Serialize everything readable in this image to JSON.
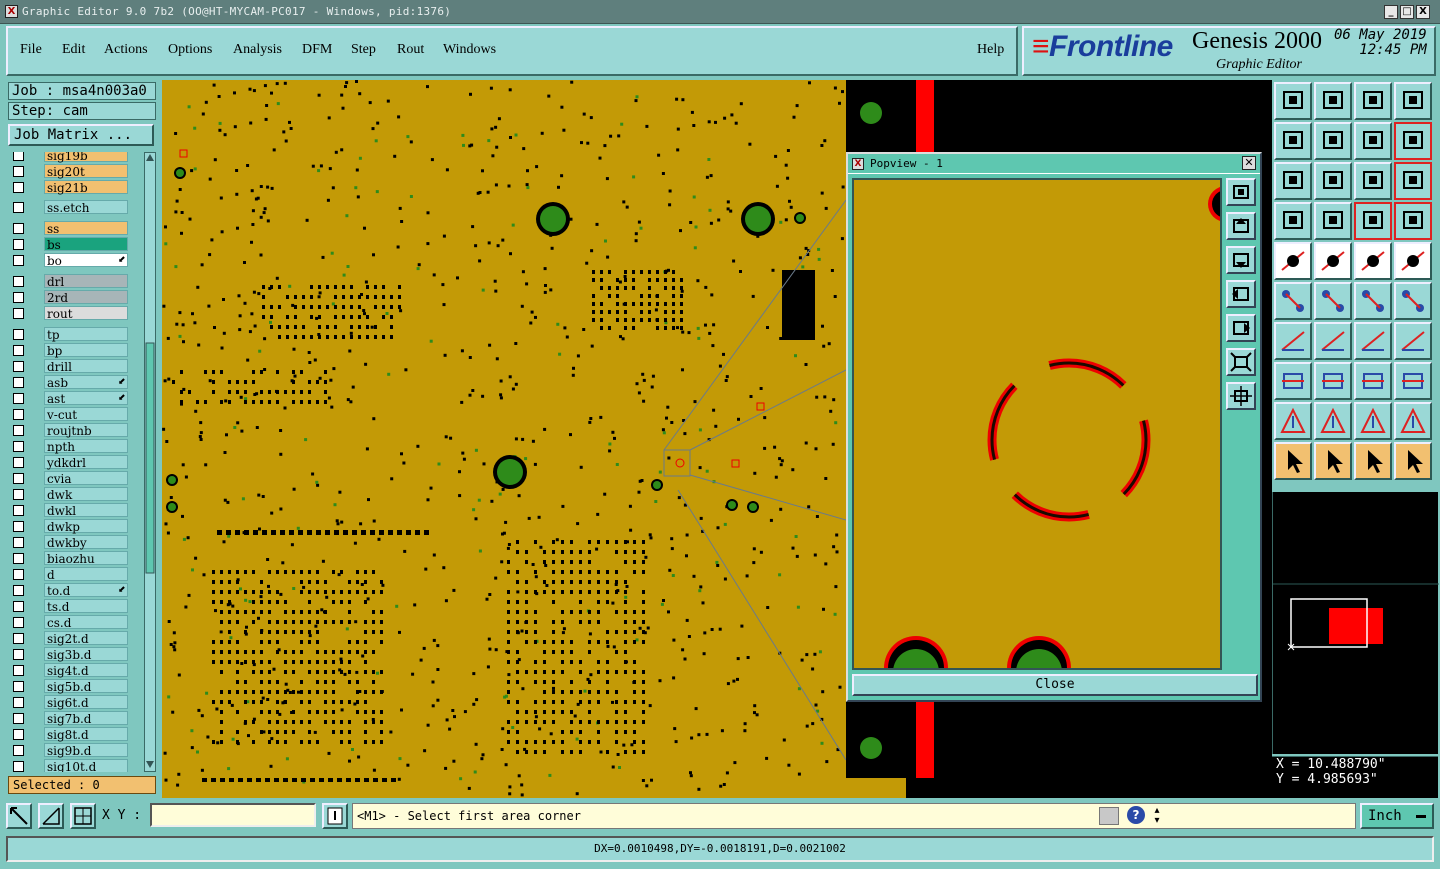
{
  "window": {
    "title": "Graphic Editor 9.0 7b2 (OO@HT-MYCAM-PC017 - Windows, pid:1376)",
    "controls": [
      "_",
      "□",
      "X"
    ]
  },
  "menu": {
    "items": [
      "File",
      "Edit",
      "Actions",
      "Options",
      "Analysis",
      "DFM",
      "Step",
      "Rout",
      "Windows"
    ],
    "help": "Help"
  },
  "branding": {
    "logo": "Frontline",
    "product": "Genesis 2000",
    "subtitle": "Graphic Editor",
    "date": "06 May 2019",
    "time": "12:45 PM"
  },
  "job": {
    "job_label": "Job : msa4n003a0",
    "step_label": "Step: cam",
    "matrix_button": "Job Matrix ..."
  },
  "layers": [
    {
      "name": "sig19b",
      "color": "#f2c070"
    },
    {
      "name": "sig20t",
      "color": "#f2c070"
    },
    {
      "name": "sig21b",
      "color": "#f2c070"
    },
    {
      "name": "ss.etch",
      "color": "#9ad8d6"
    },
    {
      "name": "ss",
      "color": "#f2c070"
    },
    {
      "name": "bs",
      "color": "#1aa37e"
    },
    {
      "name": "bo",
      "color": "#ffffff",
      "mark": true
    },
    {
      "name": "drl",
      "color": "#a7b5b8"
    },
    {
      "name": "2rd",
      "color": "#a7b5b8"
    },
    {
      "name": "rout",
      "color": "#dcdcdc"
    },
    {
      "name": "tp",
      "color": "#9ad8d6"
    },
    {
      "name": "bp",
      "color": "#9ad8d6"
    },
    {
      "name": "drill",
      "color": "#9ad8d6"
    },
    {
      "name": "asb",
      "color": "#9ad8d6",
      "mark": true
    },
    {
      "name": "ast",
      "color": "#9ad8d6",
      "mark": true
    },
    {
      "name": "v-cut",
      "color": "#9ad8d6"
    },
    {
      "name": "roujtnb",
      "color": "#9ad8d6"
    },
    {
      "name": "npth",
      "color": "#9ad8d6"
    },
    {
      "name": "ydkdrl",
      "color": "#9ad8d6"
    },
    {
      "name": "cvia",
      "color": "#9ad8d6"
    },
    {
      "name": "dwk",
      "color": "#9ad8d6"
    },
    {
      "name": "dwkl",
      "color": "#9ad8d6"
    },
    {
      "name": "dwkp",
      "color": "#9ad8d6"
    },
    {
      "name": "dwkby",
      "color": "#9ad8d6"
    },
    {
      "name": "biaozhu",
      "color": "#9ad8d6"
    },
    {
      "name": "d",
      "color": "#9ad8d6"
    },
    {
      "name": "to.d",
      "color": "#9ad8d6",
      "mark": true
    },
    {
      "name": "ts.d",
      "color": "#9ad8d6"
    },
    {
      "name": "cs.d",
      "color": "#9ad8d6"
    },
    {
      "name": "sig2t.d",
      "color": "#9ad8d6"
    },
    {
      "name": "sig3b.d",
      "color": "#9ad8d6"
    },
    {
      "name": "sig4t.d",
      "color": "#9ad8d6"
    },
    {
      "name": "sig5b.d",
      "color": "#9ad8d6"
    },
    {
      "name": "sig6t.d",
      "color": "#9ad8d6"
    },
    {
      "name": "sig7b.d",
      "color": "#9ad8d6"
    },
    {
      "name": "sig8t.d",
      "color": "#9ad8d6"
    },
    {
      "name": "sig9b.d",
      "color": "#9ad8d6"
    },
    {
      "name": "sig10t.d",
      "color": "#9ad8d6"
    }
  ],
  "selected": "Selected : 0",
  "popview": {
    "title": "Popview - 1",
    "close": "Close"
  },
  "coords": {
    "x": "X = 10.488790\"",
    "y": "Y = 4.985693\""
  },
  "bottom": {
    "xy_label": "X Y :",
    "xy_value": "",
    "message": "<M1> - Select first area corner",
    "unit": "Inch"
  },
  "status": "DX=0.0010498,DY=-0.0018191,D=0.0021002"
}
